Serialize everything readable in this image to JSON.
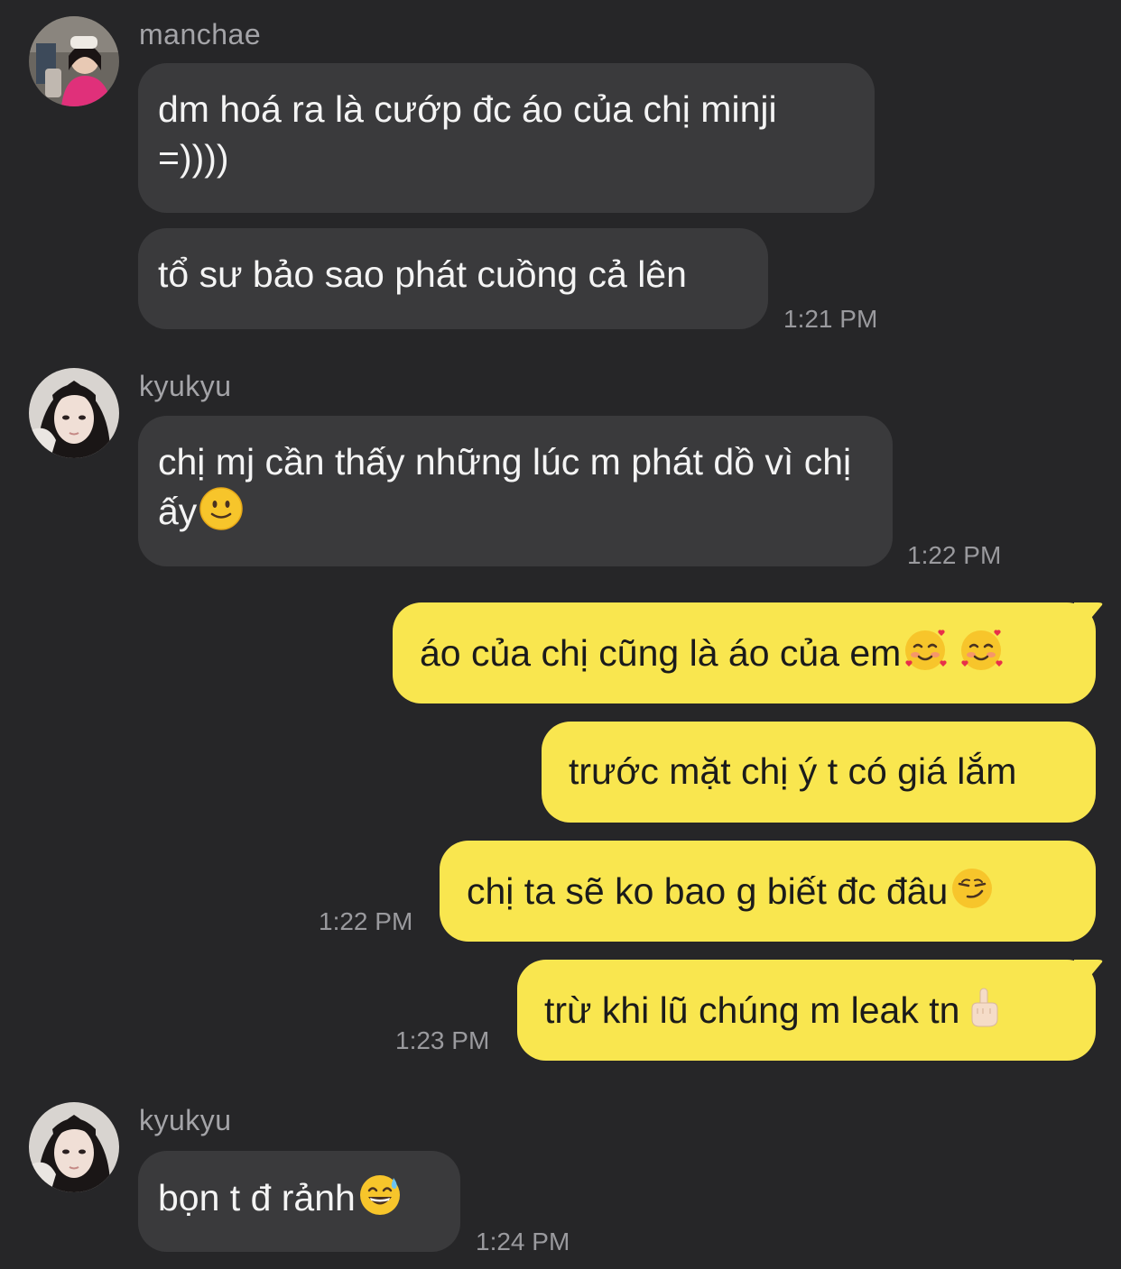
{
  "conversation": {
    "group1": {
      "sender": "manchae",
      "messages": [
        {
          "text": "dm hoá ra là cướp đc áo của chị minji =))))"
        },
        {
          "text": "tổ sư bảo sao phát cuồng cả lên"
        }
      ],
      "time": "1:21 PM"
    },
    "group2": {
      "sender": "kyukyu",
      "messages": [
        {
          "text": "chị mj cần thấy những lúc m phát dồ vì chị ấy",
          "emoji": "slightly-smiling-face-emoji"
        }
      ],
      "time": "1:22 PM"
    },
    "outgoing": {
      "messages": [
        {
          "text": "áo của chị cũng là áo của em",
          "emoji": "smiling-face-with-hearts-emoji x2"
        },
        {
          "text": "trước mặt chị ý t có giá lắm"
        },
        {
          "text": "chị ta sẽ ko bao g biết đc đâu",
          "emoji": "smirking-face-emoji",
          "time": "1:22 PM"
        },
        {
          "text": "trừ khi lũ chúng m leak tn",
          "emoji": "middle-finger-emoji",
          "time": "1:23 PM"
        }
      ]
    },
    "group3": {
      "sender": "kyukyu",
      "messages": [
        {
          "text": "bọn t đ rảnh",
          "emoji": "grinning-face-with-sweat-emoji"
        }
      ],
      "time": "1:24 PM"
    }
  },
  "colors": {
    "background": "#262628",
    "incoming_bubble": "#3a3a3c",
    "outgoing_bubble": "#f9e64f",
    "timestamp": "#9a9a9e",
    "sender_name": "#a4a4a8"
  }
}
